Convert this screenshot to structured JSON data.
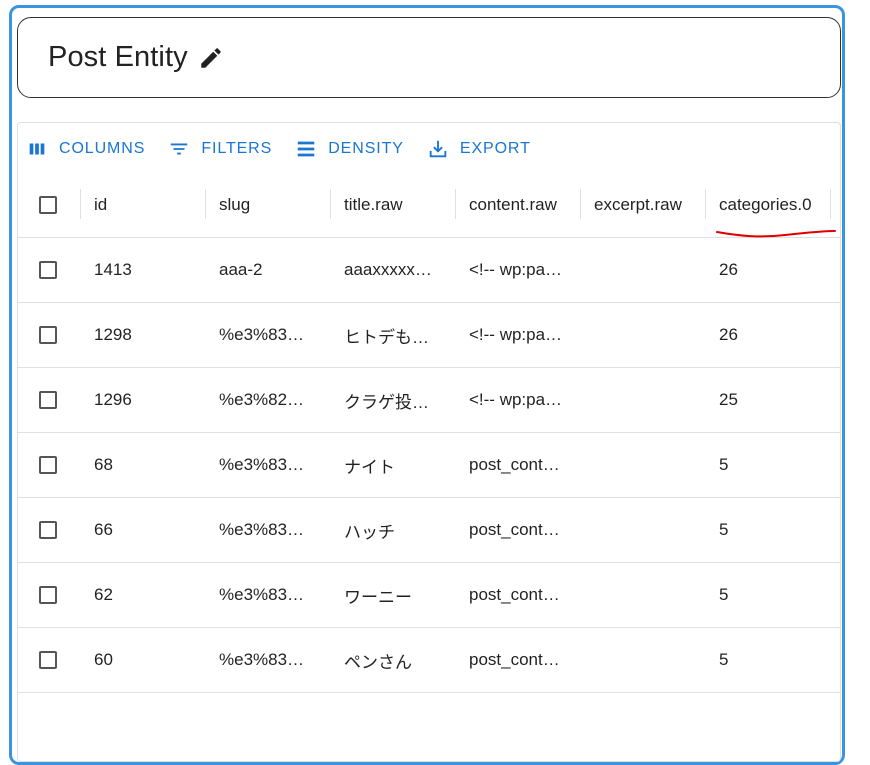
{
  "header": {
    "title": "Post Entity"
  },
  "toolbar": {
    "columns_label": "COLUMNS",
    "filters_label": "FILTERS",
    "density_label": "DENSITY",
    "export_label": "EXPORT"
  },
  "columns": [
    "id",
    "slug",
    "title.raw",
    "content.raw",
    "excerpt.raw",
    "categories.0"
  ],
  "rows": [
    {
      "id": "1413",
      "slug": "aaa-2",
      "title": "aaaxxxxx…",
      "content": "<!-- wp:pa…",
      "excerpt": "",
      "category": "26"
    },
    {
      "id": "1298",
      "slug": "%e3%83…",
      "title": "ヒトデも…",
      "content": "<!-- wp:pa…",
      "excerpt": "",
      "category": "26"
    },
    {
      "id": "1296",
      "slug": "%e3%82…",
      "title": "クラゲ投…",
      "content": "<!-- wp:pa…",
      "excerpt": "",
      "category": "25"
    },
    {
      "id": "68",
      "slug": "%e3%83…",
      "title": "ナイト",
      "content": "post_cont…",
      "excerpt": "",
      "category": "5"
    },
    {
      "id": "66",
      "slug": "%e3%83…",
      "title": "ハッチ",
      "content": "post_cont…",
      "excerpt": "",
      "category": "5"
    },
    {
      "id": "62",
      "slug": "%e3%83…",
      "title": "ワーニー",
      "content": "post_cont…",
      "excerpt": "",
      "category": "5"
    },
    {
      "id": "60",
      "slug": "%e3%83…",
      "title": "ペンさん",
      "content": "post_cont…",
      "excerpt": "",
      "category": "5"
    }
  ],
  "colors": {
    "accent": "#1976d2",
    "frame": "#3b94e0",
    "annotation": "#e00000"
  },
  "icons": {
    "edit": "pencil-icon",
    "columns": "columns-icon",
    "filters": "filter-icon",
    "density": "density-icon",
    "export": "export-icon"
  }
}
